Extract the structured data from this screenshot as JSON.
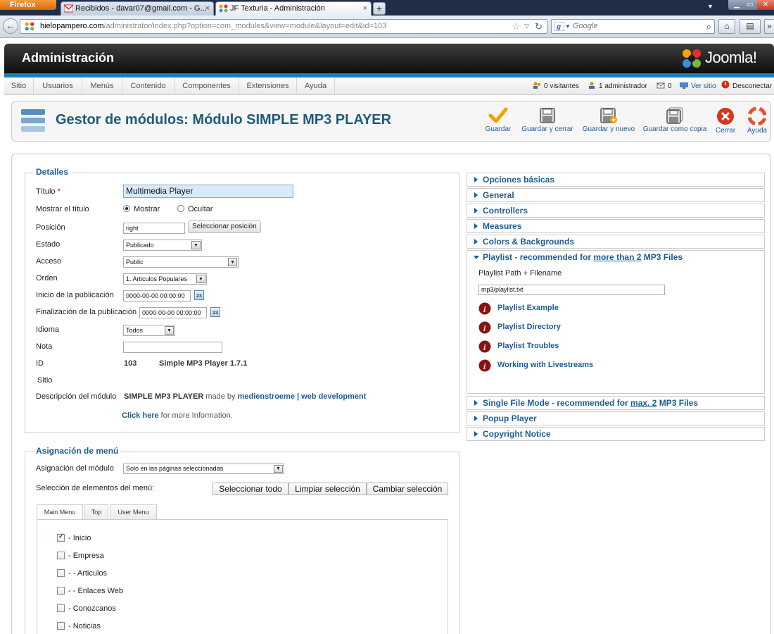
{
  "browser": {
    "app_button": "Firefox",
    "tabs": [
      {
        "label": "Recibidos - davar07@gmail.com - G...",
        "close": "×"
      },
      {
        "label": "JF Texturia - Administración",
        "close": "×"
      }
    ],
    "newtab": "+",
    "url_domain": "hielopampero.com",
    "url_path": "/administrator/index.php?option=com_modules&view=module&layout=edit&id=103",
    "search_placeholder": "Google"
  },
  "header": {
    "title": "Administración",
    "logo_text": "Joomla!"
  },
  "menubar": {
    "items": [
      "Sitio",
      "Usuarios",
      "Menús",
      "Contenido",
      "Componentes",
      "Extensiones",
      "Ayuda"
    ],
    "status": {
      "visitors": "0 visitantes",
      "admins": "1 administrador",
      "messages": "0",
      "view_site": "Ver sitio",
      "logout": "Desconectar"
    }
  },
  "toolbar": {
    "page_title": "Gestor de módulos: Módulo SIMPLE MP3 PLAYER",
    "buttons": {
      "save": "Guardar",
      "save_close": "Guardar y cerrar",
      "save_new": "Guardar y nuevo",
      "save_copy": "Guardar como copia",
      "close": "Cerrar",
      "help": "Ayuda"
    }
  },
  "details": {
    "legend": "Detalles",
    "title_label": "Título",
    "required_mark": "*",
    "title_value": "Multimedia Player",
    "showtitle_label": "Mostrar el título",
    "show_option": "Mostrar",
    "hide_option": "Ocultar",
    "position_label": "Posición",
    "position_value": "right",
    "position_button": "Seleccionar posición",
    "state_label": "Estado",
    "state_value": "Publicado",
    "access_label": "Acceso",
    "access_value": "Public",
    "order_label": "Orden",
    "order_value": "1. Articulos Populares",
    "publish_up_label": "Inicio de la publicación",
    "publish_up_value": "0000-00-00 00:00:00",
    "publish_down_label": "Finalización de la publicación",
    "publish_down_value": "0000-00-00 00:00:00",
    "calendar_glyph": "23",
    "language_label": "Idioma",
    "language_value": "Todos",
    "note_label": "Nota",
    "note_value": "",
    "id_label": "ID",
    "id_value": "103",
    "module_name": "Simple MP3 Player 1.7.1",
    "site_label": "Sitio",
    "description_label": "Descripción del módulo",
    "desc_product": "SIMPLE MP3 PLAYER",
    "desc_madeby": "made by",
    "desc_author": "medienstroeme | web development",
    "desc_click": "Click here",
    "desc_more": "for more Information."
  },
  "accordion": {
    "basic": "Opciones básicas",
    "general": "General",
    "controllers": "Controllers",
    "measures": "Measures",
    "colors": "Colors & Backgrounds",
    "playlist_a": "Playlist - recommended for ",
    "playlist_u": "more than 2",
    "playlist_b": " MP3 Files",
    "single_a": "Single File Mode - recommended for ",
    "single_u": "max. 2",
    "single_b": " MP3 Files",
    "popup": "Popup Player",
    "copyright": "Copyright Notice"
  },
  "playlist": {
    "path_label": "Playlist Path + Filename",
    "path_value": "mp3/playlist.txt",
    "links": [
      "Playlist Example",
      "Playlist Directory",
      "Playlist Troubles",
      "Working with Livestreams"
    ]
  },
  "assignment": {
    "legend": "Asignación de menú",
    "module_assign_label": "Asignación del módulo",
    "module_assign_value": "Solo en las páginas seleccionadas",
    "selection_label": "Selección de elementos del menú:",
    "select_all": "Seleccionar todo",
    "clear_selection": "Limpiar selección",
    "toggle_selection": "Cambiar selección",
    "tabs": [
      "Main Menu",
      "Top",
      "User Menu"
    ],
    "items": [
      {
        "label": "- Inicio",
        "checked": true
      },
      {
        "label": "- Empresa",
        "checked": false
      },
      {
        "label": "- - Articulos",
        "checked": false
      },
      {
        "label": "- - Enlaces Web",
        "checked": false
      },
      {
        "label": "- Conozcanos",
        "checked": false
      },
      {
        "label": "- Noticias",
        "checked": false
      }
    ]
  },
  "colors": {
    "accent": "#1d5c94",
    "header_stripe": "#1d7fb6",
    "save_check": "#f0a000",
    "close_red": "#d9351c"
  }
}
